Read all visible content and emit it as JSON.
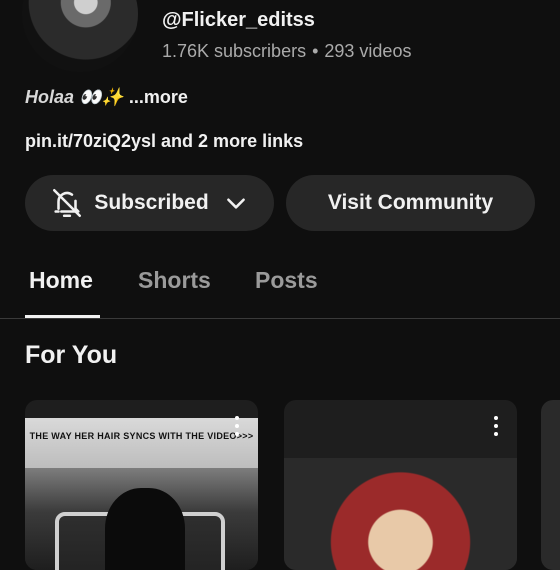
{
  "channel": {
    "handle": "@Flicker_editss",
    "subscribers": "1.76K subscribers",
    "separator": "•",
    "videos": "293 videos",
    "description_text": "Holaa 👀✨",
    "description_more": " ...more",
    "links": "pin.it/70ziQ2ysl and 2 more links"
  },
  "actions": {
    "subscribed_label": "Subscribed",
    "community_label": "Visit Community"
  },
  "tabs": [
    {
      "label": "Home",
      "active": true
    },
    {
      "label": "Shorts",
      "active": false
    },
    {
      "label": "Posts",
      "active": false
    }
  ],
  "section": {
    "title": "For You"
  },
  "cards": [
    {
      "caption": "THE WAY HER HAIR SYNCS WITH THE VIDEO>>>"
    },
    {
      "caption": ""
    }
  ],
  "colors": {
    "background": "#0f0f0f",
    "button_bg": "#272727",
    "text_primary": "#f1f1f1",
    "text_secondary": "#aaaaaa"
  },
  "icons": {
    "bell": "bell-off-icon",
    "chevron": "chevron-down-icon",
    "kebab": "more-vert-icon"
  }
}
